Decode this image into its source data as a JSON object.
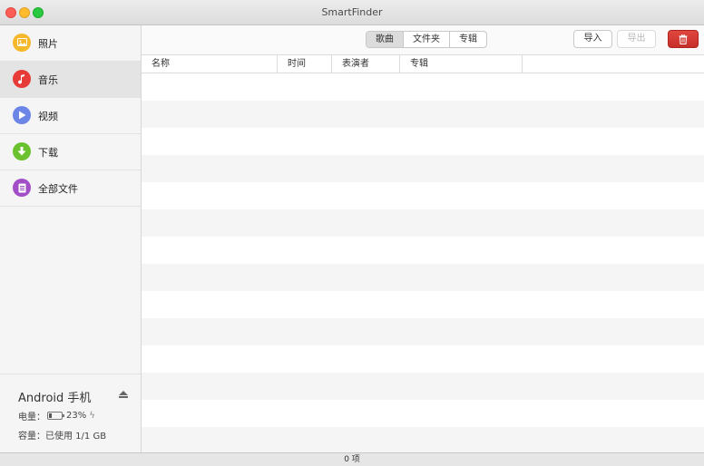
{
  "window": {
    "title": "SmartFinder"
  },
  "sidebar": {
    "items": [
      {
        "label": "照片",
        "icon": "photo-icon",
        "color": "#f6b82b"
      },
      {
        "label": "音乐",
        "icon": "music-note-icon",
        "color": "#e63b36"
      },
      {
        "label": "视频",
        "icon": "play-icon",
        "color": "#6b86e6"
      },
      {
        "label": "下载",
        "icon": "download-icon",
        "color": "#6cc12f"
      },
      {
        "label": "全部文件",
        "icon": "document-icon",
        "color": "#a24fc7"
      }
    ],
    "active_index": 1
  },
  "device": {
    "name": "Android 手机",
    "battery_label": "电量：",
    "battery_percent": "23%",
    "battery_level": 0.23,
    "capacity_text": "容量：已使用 1/1 GB"
  },
  "toolbar": {
    "tabs": [
      "歌曲",
      "文件夹",
      "专辑"
    ],
    "active_tab": 0,
    "import_label": "导入",
    "export_label": "导出",
    "delete_color": "#d0342c"
  },
  "table": {
    "columns": [
      "名称",
      "时间",
      "表演者",
      "专辑",
      ""
    ]
  },
  "status": {
    "count_text": "0 项"
  }
}
